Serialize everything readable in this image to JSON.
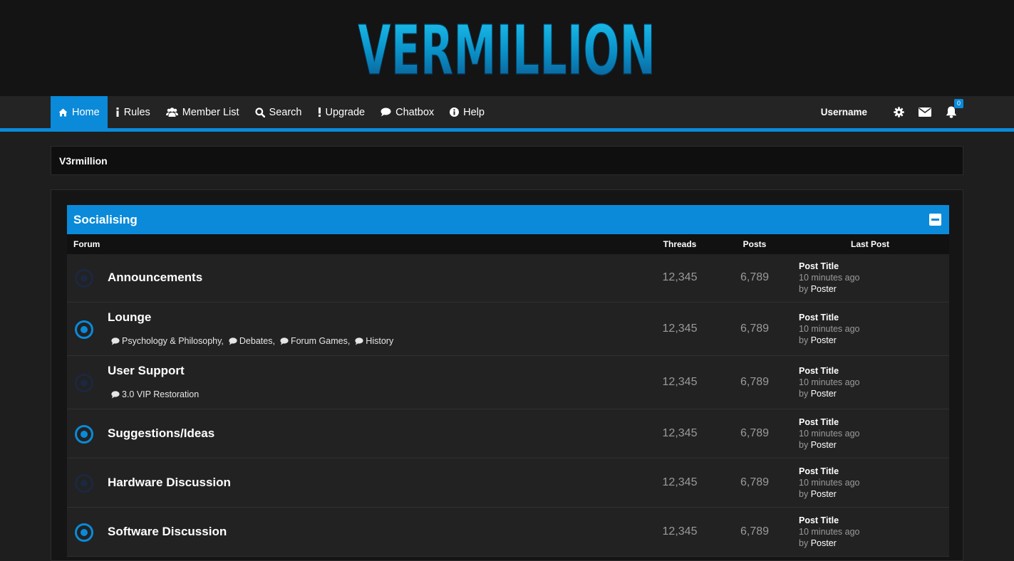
{
  "site": {
    "logo_text": "VERMILLION"
  },
  "nav": {
    "items": [
      {
        "label": "Home",
        "icon": "home-icon"
      },
      {
        "label": "Rules",
        "icon": "info-icon"
      },
      {
        "label": "Member List",
        "icon": "users-icon"
      },
      {
        "label": "Search",
        "icon": "search-icon"
      },
      {
        "label": "Upgrade",
        "icon": "exclamation-icon"
      },
      {
        "label": "Chatbox",
        "icon": "comment-icon"
      },
      {
        "label": "Help",
        "icon": "help-circle-icon"
      }
    ],
    "active": "Home",
    "username": "Username",
    "notification_count": "0"
  },
  "breadcrumb": {
    "label": "V3rmillion"
  },
  "category": {
    "title": "Socialising",
    "columns": {
      "forum": "Forum",
      "threads": "Threads",
      "posts": "Posts",
      "last_post": "Last Post"
    },
    "forums": [
      {
        "name": "Announcements",
        "subforums": [],
        "unread": false,
        "threads": "12,345",
        "posts": "6,789",
        "last_post": {
          "title": "Post Title",
          "time": "10 minutes ago",
          "by": "by",
          "poster": "Poster"
        }
      },
      {
        "name": "Lounge",
        "subforums": [
          "Psychology & Philosophy,",
          "Debates,",
          "Forum Games,",
          "History"
        ],
        "unread": true,
        "threads": "12,345",
        "posts": "6,789",
        "last_post": {
          "title": "Post Title",
          "time": "10 minutes ago",
          "by": "by",
          "poster": "Poster"
        }
      },
      {
        "name": "User Support",
        "subforums": [
          "3.0 VIP Restoration"
        ],
        "unread": false,
        "threads": "12,345",
        "posts": "6,789",
        "last_post": {
          "title": "Post Title",
          "time": "10 minutes ago",
          "by": "by",
          "poster": "Poster"
        }
      },
      {
        "name": "Suggestions/Ideas",
        "subforums": [],
        "unread": true,
        "threads": "12,345",
        "posts": "6,789",
        "last_post": {
          "title": "Post Title",
          "time": "10 minutes ago",
          "by": "by",
          "poster": "Poster"
        }
      },
      {
        "name": "Hardware Discussion",
        "subforums": [],
        "unread": false,
        "threads": "12,345",
        "posts": "6,789",
        "last_post": {
          "title": "Post Title",
          "time": "10 minutes ago",
          "by": "by",
          "poster": "Poster"
        }
      },
      {
        "name": "Software Discussion",
        "subforums": [],
        "unread": true,
        "threads": "12,345",
        "posts": "6,789",
        "last_post": {
          "title": "Post Title",
          "time": "10 minutes ago",
          "by": "by",
          "poster": "Poster"
        }
      }
    ]
  },
  "colors": {
    "accent": "#0a8ad9",
    "unread_status": "#0a8ad9",
    "read_status": "#1c2740",
    "background": "#1e1e1e",
    "row_background": "#222222"
  }
}
